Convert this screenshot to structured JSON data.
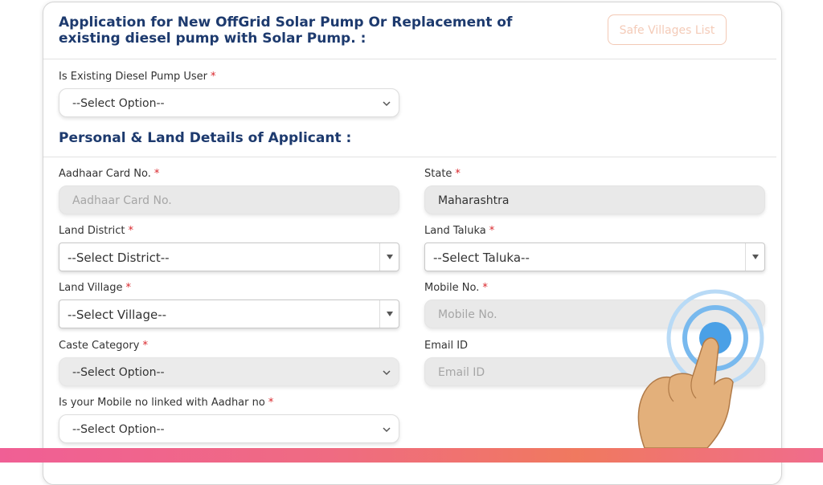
{
  "header": {
    "title": "Application for New OffGrid Solar Pump Or Replacement of existing diesel pump with Solar Pump. :",
    "safe_villages_button": "Safe Villages List"
  },
  "diesel_user": {
    "label": "Is Existing Diesel Pump User",
    "required": "*",
    "value": "--Select Option--"
  },
  "section": {
    "title": "Personal & Land Details of Applicant :"
  },
  "aadhaar": {
    "label": "Aadhaar Card No.",
    "required": "*",
    "placeholder": "Aadhaar Card No."
  },
  "state": {
    "label": "State",
    "required": "*",
    "value": "Maharashtra"
  },
  "district": {
    "label": "Land District",
    "required": "*",
    "value": "--Select District--"
  },
  "taluka": {
    "label": "Land Taluka",
    "required": "*",
    "value": "--Select Taluka--"
  },
  "village": {
    "label": "Land Village",
    "required": "*",
    "value": "--Select Village--"
  },
  "mobile": {
    "label": "Mobile No.",
    "required": "*",
    "placeholder": "Mobile No."
  },
  "caste": {
    "label": "Caste Category",
    "required": "*",
    "value": "--Select Option--"
  },
  "email": {
    "label": "Email ID",
    "placeholder": "Email ID"
  },
  "aadhar_link": {
    "label": "Is your Mobile no linked with Aadhar no",
    "required": "*",
    "value": "--Select Option--"
  },
  "colors": {
    "heading": "#1d3a6e",
    "required": "#d9262b",
    "tap_ring": "#5aa8e8",
    "bottom_bar": "#f0678a"
  },
  "icons": {
    "chevron": "chevron-down-icon",
    "dropdown": "dropdown-arrow-icon",
    "pointer": "pointing-hand-icon"
  }
}
